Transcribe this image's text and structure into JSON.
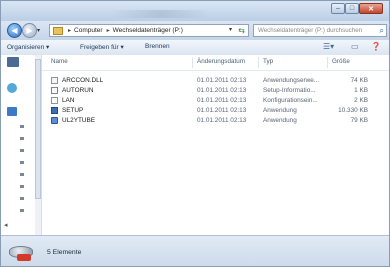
{
  "window": {
    "caption_buttons": {
      "minimize": "–",
      "maximize": "□",
      "close": "✕"
    }
  },
  "address": {
    "breadcrumbs": [
      "Computer",
      "Wechseldatenträger (P:)"
    ],
    "search_placeholder": "Wechseldatenträger (P:) durchsuchen"
  },
  "toolbar": {
    "organize": "Organisieren ▾",
    "share": "Freigeben für ▾",
    "burn": "Brennen"
  },
  "columns": {
    "name": "Name",
    "modified": "Änderungsdatum",
    "type": "Typ",
    "size": "Größe"
  },
  "files": [
    {
      "name": "ARCCON.DLL",
      "modified": "01.01.2011 02:13",
      "type": "Anwendungserwe...",
      "size": "74 KB",
      "icon": "dll-file-icon"
    },
    {
      "name": "AUTORUN",
      "modified": "01.01.2011 02:13",
      "type": "Setup-Informatio...",
      "size": "1 KB",
      "icon": "setup-info-file-icon"
    },
    {
      "name": "LAN",
      "modified": "01.01.2011 02:13",
      "type": "Konfigurationsein...",
      "size": "2 KB",
      "icon": "config-file-icon"
    },
    {
      "name": "SETUP",
      "modified": "01.01.2011 02:13",
      "type": "Anwendung",
      "size": "10.330 KB",
      "icon": "setup-app-icon"
    },
    {
      "name": "UL2YTUBE",
      "modified": "01.01.2011 02:13",
      "type": "Anwendung",
      "size": "79 KB",
      "icon": "ul2ytube-app-icon"
    }
  ],
  "status": {
    "count_text": "5 Elemente"
  },
  "colors": {
    "window_frame": "#cfd9e6",
    "close_red": "#c2452b",
    "header_text": "#4c607a"
  }
}
